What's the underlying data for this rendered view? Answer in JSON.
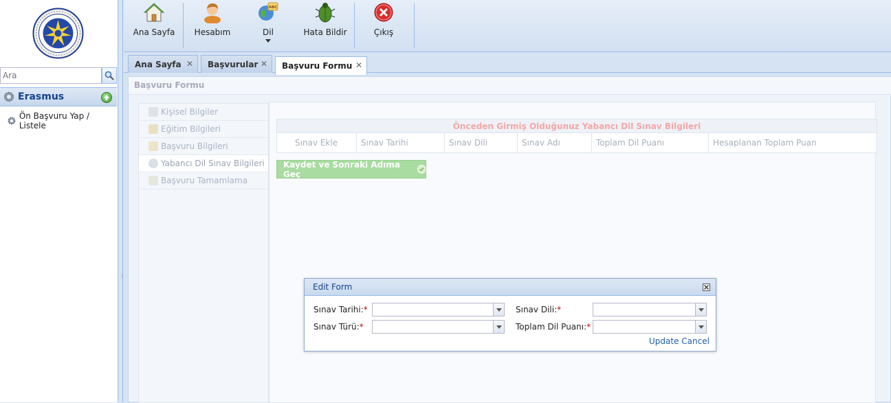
{
  "left": {
    "search_placeholder": "Ara",
    "module_title": "Erasmus",
    "menu_item": "Ön Başvuru Yap / Listele",
    "logo_icon": "university-seal-icon"
  },
  "toolbar": {
    "home": "Ana Sayfa",
    "account": "Hesabım",
    "language": "Dil",
    "report_bug": "Hata Bildir",
    "logout": "Çıkış"
  },
  "tabs": [
    {
      "label": "Ana Sayfa",
      "close": "✕"
    },
    {
      "label": "Başvurular",
      "close": "✕"
    },
    {
      "label": "Başvuru Formu",
      "close": "✕"
    }
  ],
  "form": {
    "title": "Başvuru Formu",
    "steps": [
      {
        "label": "Kişisel Bilgiler"
      },
      {
        "label": "Eğitim Bilgileri"
      },
      {
        "label": "Başvuru Bilgileri"
      },
      {
        "label": "Yabancı Dil Sınav Bilgileri"
      },
      {
        "label": "Başvuru Tamamlama"
      }
    ],
    "grid_title": "Önceden Girmiş Olduğunuz Yabancı Dil Sınav Bilgileri",
    "columns": [
      "Sınav Ekle",
      "Sınav Tarihi",
      "Sınav Dili",
      "Sınav Adı",
      "Toplam Dil Puanı",
      "Hesaplanan Toplam Puan"
    ],
    "save_button": "Kaydet ve Sonraki Adıma Geç"
  },
  "dialog": {
    "title": "Edit Form",
    "fields": {
      "exam_date": "Sınav Tarihi:",
      "exam_type": "Sınav Türü:",
      "exam_language": "Sınav Dili:",
      "total_score": "Toplam Dil Puanı:"
    },
    "required_mark": "*",
    "update": "Update",
    "cancel": "Cancel"
  },
  "colors": {
    "accent": "#15428b",
    "grid_title": "#f5a7a7",
    "save_button": "#a8dca1"
  }
}
